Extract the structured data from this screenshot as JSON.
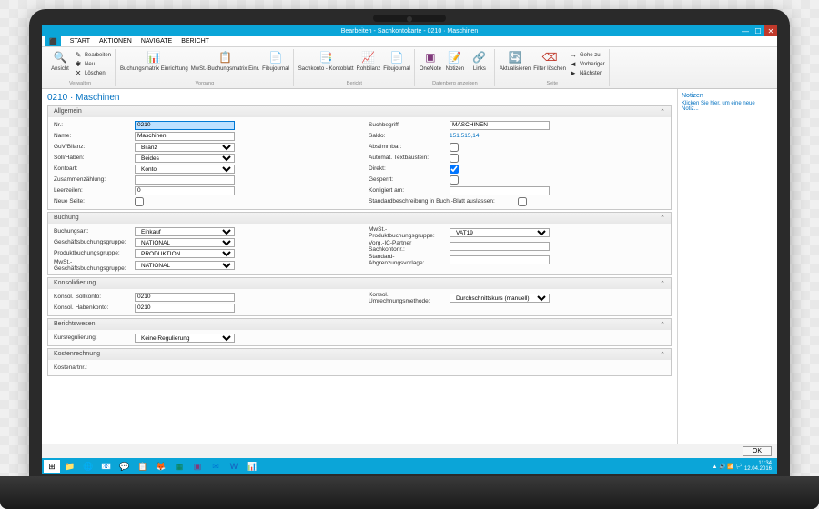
{
  "window": {
    "title": "Bearbeiten - Sachkontokarte - 0210 · Maschinen"
  },
  "menu": {
    "file": "⬛",
    "tabs": [
      "START",
      "AKTIONEN",
      "NAVIGATE",
      "BERICHT"
    ]
  },
  "ribbon": {
    "g1": {
      "label": "Verwalten",
      "view": "Ansicht",
      "items": [
        "Bearbeiten",
        "Neu",
        "Löschen"
      ]
    },
    "g2": {
      "label": "Vorgang",
      "a": "Buchungsmatrix Einrichtung",
      "b": "MwSt.-Buchungsmatrix Einr.",
      "c": "Fibujournal"
    },
    "g3": {
      "label": "Bericht",
      "a": "Sachkonto - Kontoblatt",
      "b": "Rohbilanz",
      "c": "Fibujournal"
    },
    "g4": {
      "label": "Datenberg anzeigen",
      "a": "OneNote",
      "b": "Notizen",
      "c": "Links"
    },
    "g5": {
      "label": "Seite",
      "a": "Aktualisieren",
      "b": "Filter löschen",
      "c": "Gehe zu",
      "d": "Vorheriger",
      "e": "Nächster"
    }
  },
  "page": {
    "title": "0210 · Maschinen"
  },
  "sections": {
    "allgemein": {
      "title": "Allgemein",
      "nr": {
        "l": "Nr.:",
        "v": "0210"
      },
      "name": {
        "l": "Name:",
        "v": "Maschinen"
      },
      "guv": {
        "l": "GuV/Bilanz:",
        "v": "Bilanz"
      },
      "soll": {
        "l": "Soll/Haben:",
        "v": "Beides"
      },
      "kontoart": {
        "l": "Kontoart:",
        "v": "Konto"
      },
      "zusammen": {
        "l": "Zusammenzählung:",
        "v": ""
      },
      "leer": {
        "l": "Leerzeilen:",
        "v": "0"
      },
      "neuseite": {
        "l": "Neue Seite:",
        "v": false
      },
      "such": {
        "l": "Suchbegriff:",
        "v": "MASCHINEN"
      },
      "saldo": {
        "l": "Saldo:",
        "v": "151.515,14"
      },
      "abstimm": {
        "l": "Abstimmbar:",
        "v": false
      },
      "autotext": {
        "l": "Automat. Textbaustein:",
        "v": false
      },
      "direkt": {
        "l": "Direkt:",
        "v": true
      },
      "gesperrt": {
        "l": "Gesperrt:",
        "v": false
      },
      "korr": {
        "l": "Korrigiert am:",
        "v": ""
      },
      "stdbesch": {
        "l": "Standardbeschreibung in Buch.-Blatt auslassen:",
        "v": false
      }
    },
    "buchung": {
      "title": "Buchung",
      "art": {
        "l": "Buchungsart:",
        "v": "Einkauf"
      },
      "gesch": {
        "l": "Geschäftsbuchungsgruppe:",
        "v": "NATIONAL"
      },
      "prod": {
        "l": "Produktbuchungsgruppe:",
        "v": "PRODUKTION"
      },
      "mwstg": {
        "l": "MwSt.-Geschäftsbuchungsgruppe:",
        "v": "NATIONAL"
      },
      "mwstp": {
        "l": "MwSt.-Produktbuchungsgruppe:",
        "v": "VAT19"
      },
      "vorg": {
        "l": "Vorg.-IC-Partner Sachkontonr.:",
        "v": ""
      },
      "stdab": {
        "l": "Standard-Abgrenzungsvorlage:",
        "v": ""
      }
    },
    "konsol": {
      "title": "Konsolidierung",
      "soll": {
        "l": "Konsol. Sollkonto:",
        "v": "0210"
      },
      "haben": {
        "l": "Konsol. Habenkonto:",
        "v": "0210"
      },
      "umr": {
        "l": "Konsol. Umrechnungsmethode:",
        "v": "Durchschnittskurs (manuell)"
      }
    },
    "bericht": {
      "title": "Berichtswesen",
      "kurs": {
        "l": "Kursregulierung:",
        "v": "Keine Regulierung"
      }
    },
    "kosten": {
      "title": "Kostenrechnung",
      "art": {
        "l": "Kostenartnr.:",
        "v": ""
      }
    }
  },
  "sidebar": {
    "title": "Notizen",
    "hint": "Klicken Sie hier, um eine neue Notiz..."
  },
  "footer": {
    "ok": "OK"
  },
  "tray": {
    "time": "11:34",
    "date": "12.04.2016"
  }
}
